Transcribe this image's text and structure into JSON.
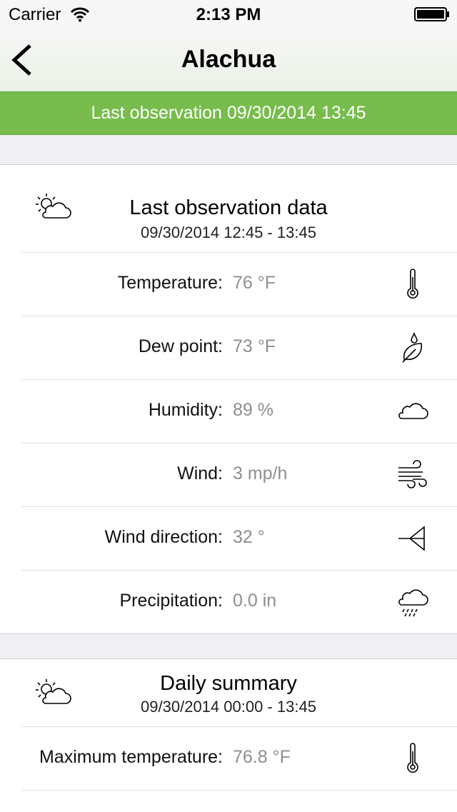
{
  "status_bar": {
    "carrier": "Carrier",
    "time": "2:13 PM"
  },
  "navbar": {
    "title": "Alachua",
    "back_icon": "chevron-left-icon"
  },
  "banner": {
    "text": "Last observation 09/30/2014 13:45",
    "color": "#77bc4c"
  },
  "last_observation": {
    "title": "Last observation data",
    "subtitle": "09/30/2014 12:45 - 13:45",
    "icon": "partly-cloudy-icon",
    "rows": [
      {
        "label": "Temperature:",
        "value": "76 °F",
        "icon": "thermometer-icon"
      },
      {
        "label": "Dew point:",
        "value": "73 °F",
        "icon": "dew-point-icon"
      },
      {
        "label": "Humidity:",
        "value": "89 %",
        "icon": "cloud-icon"
      },
      {
        "label": "Wind:",
        "value": "3 mp/h",
        "icon": "wind-icon"
      },
      {
        "label": "Wind direction:",
        "value": "32 °",
        "icon": "wind-direction-icon"
      },
      {
        "label": "Precipitation:",
        "value": "0.0 in",
        "icon": "rain-cloud-icon"
      }
    ]
  },
  "daily_summary": {
    "title": "Daily summary",
    "subtitle": "09/30/2014  00:00 - 13:45",
    "icon": "partly-cloudy-icon",
    "rows": [
      {
        "label": "Maximum temperature:",
        "value": "76.8 °F",
        "icon": "thermometer-icon"
      }
    ]
  }
}
